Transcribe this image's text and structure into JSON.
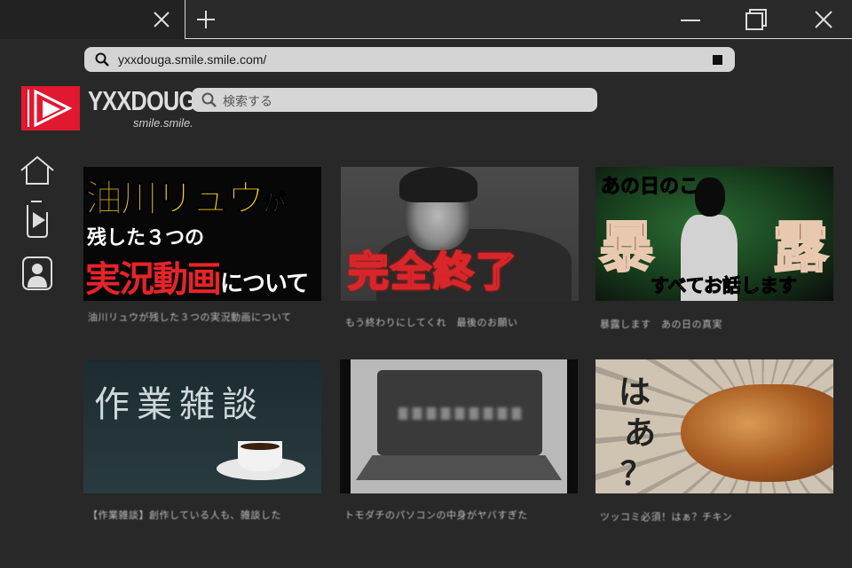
{
  "browser": {
    "url": "yxxdouga.smile.smile.com/"
  },
  "site": {
    "brand": "YXXDOUGA",
    "brand_sub": "smile.smile.",
    "search_placeholder": "検索する"
  },
  "sidebar": [
    "home-icon",
    "clip-icon",
    "user-icon"
  ],
  "videos": [
    {
      "title": "油川リュウが残した３つの実況動画について",
      "meta": "",
      "thumb": {
        "line1": "油川リュウ",
        "line1_suffix": "が",
        "line2": "残した３つの",
        "line3": "実況動画",
        "line3_suffix": "について"
      }
    },
    {
      "title": "もう終わりにしてくれ　最後のお願い",
      "meta": "",
      "thumb": {
        "text": "完全終了"
      }
    },
    {
      "title": "暴露します　あの日の真実",
      "meta": "",
      "thumb": {
        "top": "あの日のこ",
        "k1": "暴",
        "k2": "露",
        "bottom": "すべてお話します"
      }
    },
    {
      "title": "【作業雑談】創作している人も、雑談した",
      "meta": "",
      "thumb": {
        "text": "作業雑談"
      }
    },
    {
      "title": "トモダチのパソコンの中身がヤバすぎた",
      "meta": "",
      "thumb": {}
    },
    {
      "title": "ツッコミ必須！はぁ？チキン",
      "meta": "",
      "thumb": {
        "line1": "は",
        "line2": "あ",
        "line3": "？"
      }
    }
  ]
}
